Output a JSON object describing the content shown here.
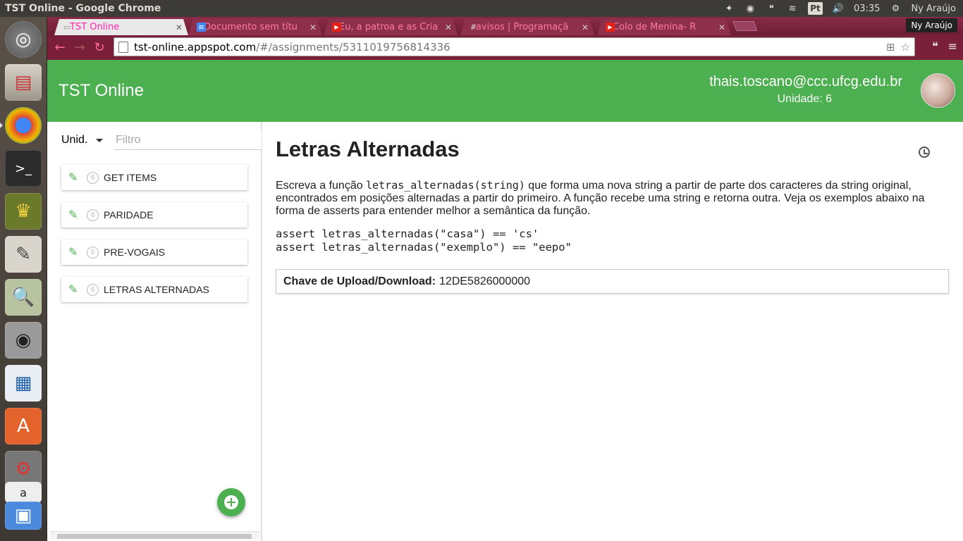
{
  "os": {
    "window_title": "TST Online - Google Chrome",
    "clock": "03:35",
    "user": "Ny Araújo",
    "keyboard_layout": "Pt"
  },
  "browser": {
    "tabs": [
      {
        "title": "TST Online",
        "icon": "tst-icon",
        "active": true
      },
      {
        "title": "Documento sem títu",
        "icon": "docs-icon",
        "active": false
      },
      {
        "title": "Eu, a patroa e as Cria",
        "icon": "youtube-icon",
        "active": false
      },
      {
        "title": "avisos | Programaçã",
        "icon": "slack-icon",
        "active": false
      },
      {
        "title": "Colo de Menina- R",
        "icon": "youtube-icon",
        "active": false
      }
    ],
    "profile_name": "Ny Araújo",
    "url_host": "tst-online.appspot.com",
    "url_path": "/#/assignments/5311019756814336",
    "accent_color": "#7a1f3a"
  },
  "app": {
    "title": "TST Online",
    "user_email": "thais.toscano@ccc.ufcg.edu.br",
    "user_unit": "Unidade: 6",
    "brand_color": "#4caf50"
  },
  "sidebar": {
    "unit_select_label": "Unid.",
    "filter_placeholder": "Filtro",
    "assignments": [
      {
        "name": "GET ITEMS",
        "unit": "6"
      },
      {
        "name": "PARIDADE",
        "unit": "6"
      },
      {
        "name": "PRE-VOGAIS",
        "unit": "6"
      },
      {
        "name": "LETRAS ALTERNADAS",
        "unit": "6"
      }
    ]
  },
  "main": {
    "title": "Letras Alternadas",
    "desc_before": "Escreva a função ",
    "desc_code": "letras_alternadas(string)",
    "desc_after": " que forma uma nova string a partir de parte dos caracteres da string original, encontrados em posições alternadas a partir do primeiro. A função recebe uma string e retorna outra. Veja os exemplos abaixo na forma de asserts para entender melhor a semântica da função.",
    "code_lines": [
      "assert letras_alternadas(\"casa\") == 'cs'",
      "assert letras_alternadas(\"exemplo\") == \"eepo\""
    ],
    "key_label": "Chave de Upload/Download:",
    "key_value": "12DE5826000000"
  }
}
